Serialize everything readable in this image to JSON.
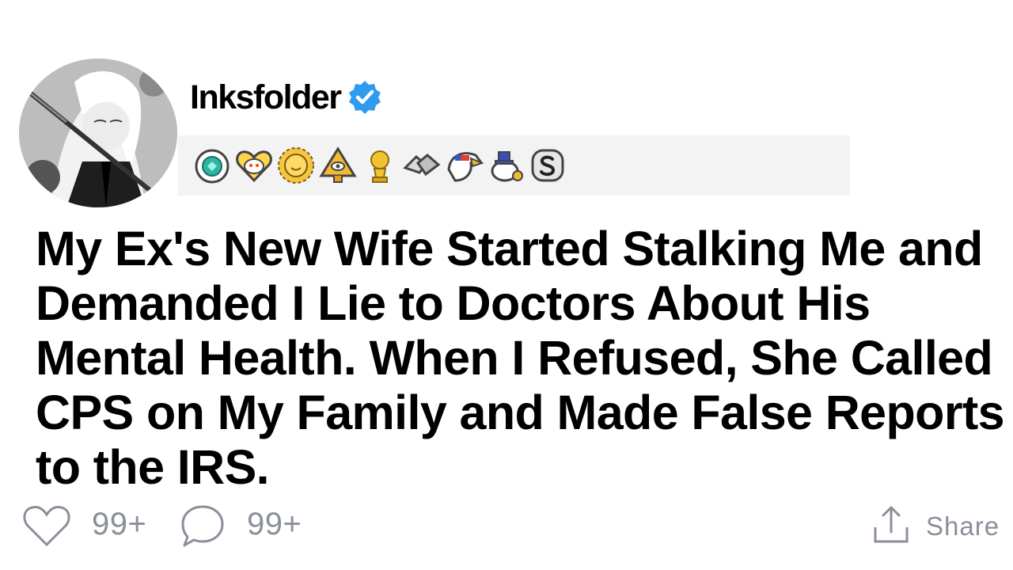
{
  "post": {
    "author": "Inksfolder",
    "verified": true,
    "title": "My Ex's New Wife Started Stalking Me and Demanded I Lie to Doctors About His Mental Health. When I Refused, She Called CPS on My Family and Made False Reports to the IRS."
  },
  "awards": [
    {
      "icon": "diamond-award-icon"
    },
    {
      "icon": "heart-snoo-award-icon"
    },
    {
      "icon": "sun-award-icon"
    },
    {
      "icon": "pyramid-eye-award-icon"
    },
    {
      "icon": "trophy-snoo-award-icon"
    },
    {
      "icon": "handshake-award-icon"
    },
    {
      "icon": "eagle-award-icon"
    },
    {
      "icon": "snoo-hat-award-icon"
    },
    {
      "icon": "silver-s-award-icon"
    }
  ],
  "actions": {
    "likes": "99+",
    "comments": "99+",
    "share_label": "Share"
  },
  "colors": {
    "verified_blue": "#2d9bf0",
    "muted_text": "#8a8f99",
    "awards_bg": "#f3f3f3"
  }
}
